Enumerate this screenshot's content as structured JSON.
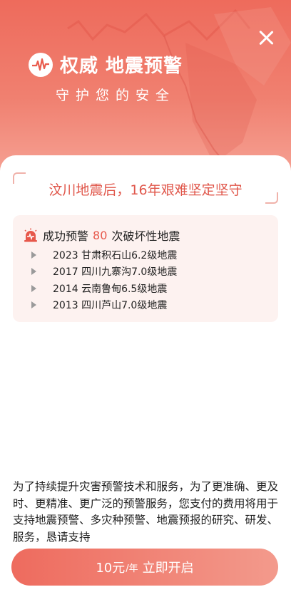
{
  "hero": {
    "title": "权威 地震预警",
    "subtitle": "守护您的安全"
  },
  "motto": "汶川地震后，16年艰难坚定坚守",
  "record": {
    "prefix": "成功预警",
    "count": "80",
    "suffix": "次破坏性地震",
    "events": [
      "2023 甘肃积石山6.2级地震",
      "2017 四川九寨沟7.0级地震",
      "2014 云南鲁甸6.5级地震",
      "2013 四川芦山7.0级地震"
    ]
  },
  "description": "为了持续提升灾害预警技术和服务，为了更准确、更及时、更精准、更广泛的预警服务，您支付的费用将用于支持地震预警、多灾种预警、地震预报的研究、研发、服务，恳请支持",
  "cta": {
    "price": "10元",
    "unit": "/年",
    "action": "立即开启"
  },
  "colors": {
    "accent": "#e7584b",
    "hero_top": "#ee6b5c",
    "panel_bg": "#fdf2f0"
  },
  "icons": [
    "close-icon",
    "logo-icon",
    "alarm-icon",
    "triangle-bullet-icon"
  ]
}
